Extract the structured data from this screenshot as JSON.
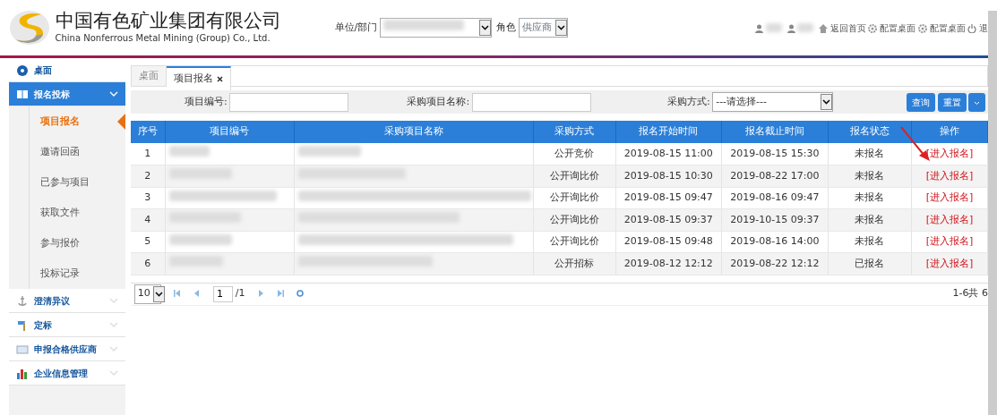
{
  "header": {
    "company_cn": "中国有色矿业集团有限公司",
    "company_en": "China Nonferrous Metal Mining (Group) Co., Ltd.",
    "unit_label": "单位/部门",
    "role_label": "角色",
    "role_value": "供应商",
    "links": [
      {
        "kind": "home",
        "label": "返回首页"
      },
      {
        "kind": "config",
        "label": "配置桌面"
      },
      {
        "kind": "config",
        "label": "配置桌面"
      },
      {
        "kind": "exit",
        "label": "退"
      }
    ]
  },
  "sidebar": {
    "items": [
      {
        "kind": "link",
        "label": "桌面",
        "expanded": false
      },
      {
        "kind": "group",
        "label": "报名投标",
        "expanded": true,
        "children": [
          {
            "label": "项目报名",
            "selected": true
          },
          {
            "label": "邀请回函",
            "selected": false
          },
          {
            "label": "已参与项目",
            "selected": false
          },
          {
            "label": "获取文件",
            "selected": false
          },
          {
            "label": "参与报价",
            "selected": false
          },
          {
            "label": "投标记录",
            "selected": false
          }
        ]
      },
      {
        "kind": "group",
        "label": "澄清异议",
        "expanded": false
      },
      {
        "kind": "group",
        "label": "定标",
        "expanded": false
      },
      {
        "kind": "group",
        "label": "申报合格供应商",
        "expanded": false
      },
      {
        "kind": "group",
        "label": "企业信息管理",
        "expanded": false
      }
    ]
  },
  "tabs": [
    {
      "label": "桌面",
      "selected": false,
      "closable": false
    },
    {
      "label": "项目报名",
      "selected": true,
      "closable": true
    }
  ],
  "filters": {
    "project_no_label": "项目编号:",
    "project_name_label": "采购项目名称:",
    "method_label": "采购方式:",
    "method_value": "---请选择---",
    "buttons": [
      "查询",
      "重置"
    ]
  },
  "table": {
    "columns": [
      "序号",
      "项目编号",
      "采购项目名称",
      "采购方式",
      "报名开始时间",
      "报名截止时间",
      "报名状态",
      "操作"
    ],
    "rows": [
      {
        "seq": "1",
        "method": "公开竞价",
        "start": "2019-08-15 11:00",
        "end": "2019-08-15 15:30",
        "status": "未报名",
        "action": "[进入报名]"
      },
      {
        "seq": "2",
        "method": "公开询比价",
        "start": "2019-08-15 10:30",
        "end": "2019-08-22 17:00",
        "status": "未报名",
        "action": "[进入报名]"
      },
      {
        "seq": "3",
        "method": "公开询比价",
        "start": "2019-08-15 09:47",
        "end": "2019-08-16 09:47",
        "status": "未报名",
        "action": "[进入报名]"
      },
      {
        "seq": "4",
        "method": "公开询比价",
        "start": "2019-08-15 09:37",
        "end": "2019-10-15 09:37",
        "status": "未报名",
        "action": "[进入报名]"
      },
      {
        "seq": "5",
        "method": "公开询比价",
        "start": "2019-08-15 09:48",
        "end": "2019-08-16 14:00",
        "status": "未报名",
        "action": "[进入报名]"
      },
      {
        "seq": "6",
        "method": "公开招标",
        "start": "2019-08-12 12:12",
        "end": "2019-08-22 12:12",
        "status": "已报名",
        "action": "[进入报名]"
      }
    ]
  },
  "pager": {
    "page_size": "10",
    "page": "1",
    "total_pages": "/1",
    "summary": "1-6共 6"
  }
}
